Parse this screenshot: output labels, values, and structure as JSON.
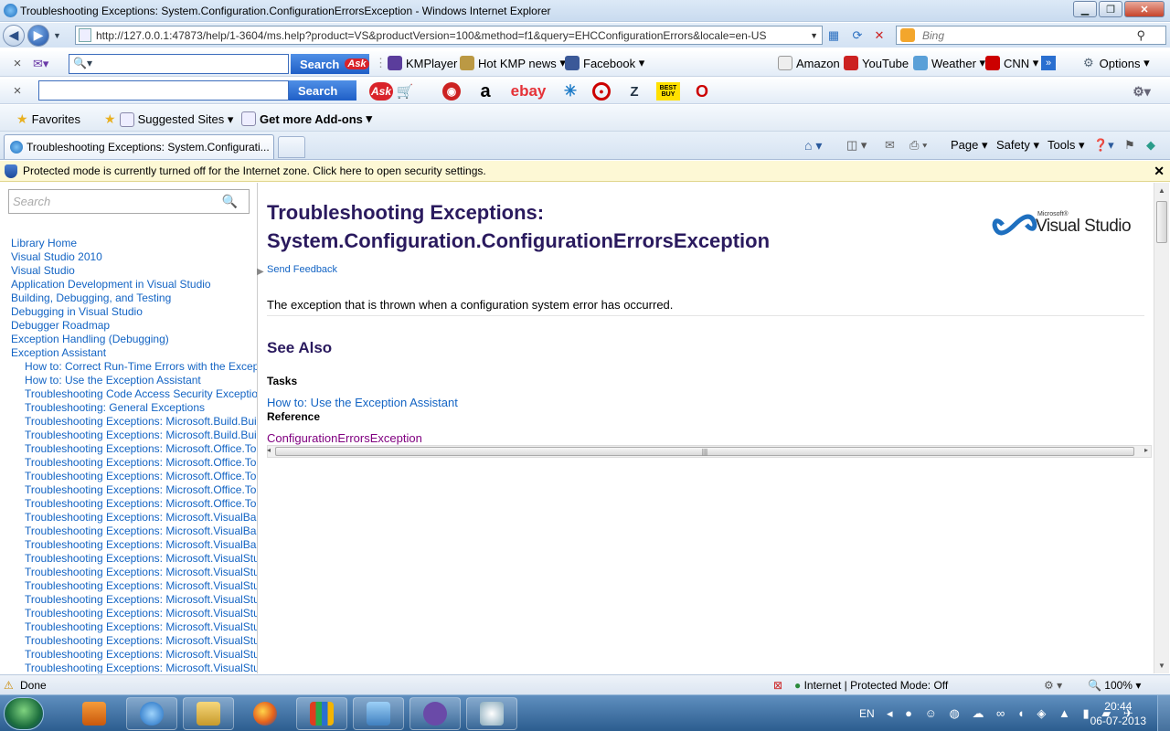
{
  "window": {
    "title": "Troubleshooting Exceptions: System.Configuration.ConfigurationErrorsException - Windows Internet Explorer"
  },
  "address": {
    "url": "http://127.0.0.1:47873/help/1-3604/ms.help?product=VS&productVersion=100&method=f1&query=EHCConfigurationErrors&locale=en-US",
    "search_placeholder": "Bing"
  },
  "toolbar1": {
    "search_label": "Search",
    "kmplayer": "KMPlayer",
    "hotkmp": "Hot KMP news",
    "facebook": "Facebook",
    "amazon": "Amazon",
    "youtube": "YouTube",
    "weather": "Weather",
    "cnn": "CNN",
    "options": "Options"
  },
  "toolbar2": {
    "search_label": "Search",
    "ask": "Ask",
    "amazon_logo": "a",
    "ebay": "ebay",
    "bestbuy": "BEST BUY",
    "zappos": "Z"
  },
  "favbar": {
    "favorites": "Favorites",
    "suggested": "Suggested Sites",
    "addons": "Get more Add-ons"
  },
  "tab": {
    "title": "Troubleshooting Exceptions: System.Configurati..."
  },
  "commandbar": {
    "page": "Page",
    "safety": "Safety",
    "tools": "Tools"
  },
  "infobar": {
    "message": "Protected mode is currently turned off for the Internet zone.  Click here to open security settings."
  },
  "left": {
    "search_placeholder": "Search",
    "toc": [
      {
        "label": "Library Home",
        "sub": false
      },
      {
        "label": "Visual Studio 2010",
        "sub": false
      },
      {
        "label": "Visual Studio",
        "sub": false
      },
      {
        "label": "Application Development in Visual Studio",
        "sub": false
      },
      {
        "label": "Building, Debugging, and Testing",
        "sub": false
      },
      {
        "label": "Debugging in Visual Studio",
        "sub": false
      },
      {
        "label": "Debugger Roadmap",
        "sub": false
      },
      {
        "label": "Exception Handling (Debugging)",
        "sub": false
      },
      {
        "label": "Exception Assistant",
        "sub": false
      },
      {
        "label": "How to: Correct Run-Time Errors with the Except",
        "sub": true
      },
      {
        "label": "How to: Use the Exception Assistant",
        "sub": true
      },
      {
        "label": "Troubleshooting Code Access Security Exception",
        "sub": true
      },
      {
        "label": "Troubleshooting: General Exceptions",
        "sub": true
      },
      {
        "label": "Troubleshooting Exceptions: Microsoft.Build.Buil",
        "sub": true
      },
      {
        "label": "Troubleshooting Exceptions: Microsoft.Build.Buil",
        "sub": true
      },
      {
        "label": "Troubleshooting Exceptions: Microsoft.Office.To",
        "sub": true
      },
      {
        "label": "Troubleshooting Exceptions: Microsoft.Office.To",
        "sub": true
      },
      {
        "label": "Troubleshooting Exceptions: Microsoft.Office.To",
        "sub": true
      },
      {
        "label": "Troubleshooting Exceptions: Microsoft.Office.To",
        "sub": true
      },
      {
        "label": "Troubleshooting Exceptions: Microsoft.Office.To",
        "sub": true
      },
      {
        "label": "Troubleshooting Exceptions: Microsoft.VisualBas",
        "sub": true
      },
      {
        "label": "Troubleshooting Exceptions: Microsoft.VisualBas",
        "sub": true
      },
      {
        "label": "Troubleshooting Exceptions: Microsoft.VisualBas",
        "sub": true
      },
      {
        "label": "Troubleshooting Exceptions: Microsoft.VisualStu",
        "sub": true
      },
      {
        "label": "Troubleshooting Exceptions: Microsoft.VisualStu",
        "sub": true
      },
      {
        "label": "Troubleshooting Exceptions: Microsoft.VisualStu",
        "sub": true
      },
      {
        "label": "Troubleshooting Exceptions: Microsoft.VisualStu",
        "sub": true
      },
      {
        "label": "Troubleshooting Exceptions: Microsoft.VisualStu",
        "sub": true
      },
      {
        "label": "Troubleshooting Exceptions: Microsoft.VisualStu",
        "sub": true
      },
      {
        "label": "Troubleshooting Exceptions: Microsoft.VisualStu",
        "sub": true
      },
      {
        "label": "Troubleshooting Exceptions: Microsoft.VisualStu",
        "sub": true
      },
      {
        "label": "Troubleshooting Exceptions: Microsoft.VisualStu",
        "sub": true
      }
    ]
  },
  "main": {
    "title_line1": "Troubleshooting Exceptions:",
    "title_line2": "System.Configuration.ConfigurationErrorsException",
    "logo_small": "Microsoft®",
    "logo_text": "Visual Studio",
    "feedback": "Send Feedback",
    "description": "The exception that is thrown when a configuration system error has occurred.",
    "see_also": "See Also",
    "tasks_heading": "Tasks",
    "tasks_link": "How to: Use the Exception Assistant",
    "reference_heading": "Reference",
    "reference_link": "ConfigurationErrorsException"
  },
  "status": {
    "done": "Done",
    "zone": "Internet | Protected Mode: Off",
    "zoom": "100%"
  },
  "taskbar": {
    "lang": "EN",
    "time": "20:44",
    "date": "06-07-2013"
  },
  "colors": {
    "link": "#1364c4",
    "visited": "#800080",
    "heading": "#2a1a5e",
    "infobar": "#fdf8d5"
  }
}
